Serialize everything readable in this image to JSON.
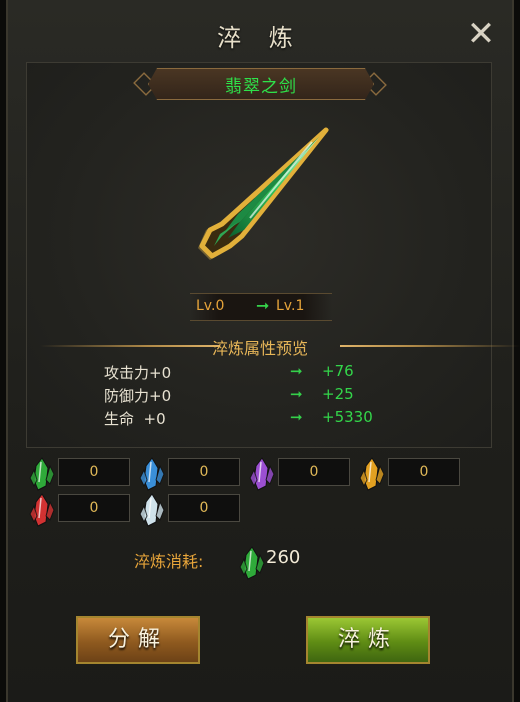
{
  "window": {
    "title": "淬 炼",
    "close_label": "✕"
  },
  "item": {
    "name": "翡翠之剑",
    "icon": "emerald-sword-icon"
  },
  "level": {
    "from": "Lv.0",
    "arrow": "➞",
    "to": "Lv.1"
  },
  "preview": {
    "title": "淬炼属性预览",
    "stats": [
      {
        "label": "攻击力+0",
        "arrow": "➞",
        "value": "+76"
      },
      {
        "label": "防御力+0",
        "arrow": "➞",
        "value": "+25"
      },
      {
        "label": "生命  +0",
        "arrow": "➞",
        "value": "+5330"
      }
    ]
  },
  "materials": [
    {
      "icon": "green-crystal-icon",
      "count": "0",
      "color": "#2faa3a"
    },
    {
      "icon": "blue-crystal-icon",
      "count": "0",
      "color": "#3a8fd8"
    },
    {
      "icon": "purple-crystal-icon",
      "count": "0",
      "color": "#9b4fd1"
    },
    {
      "icon": "orange-crystal-icon",
      "count": "0",
      "color": "#e2a021"
    },
    {
      "icon": "red-crystal-icon",
      "count": "0",
      "color": "#d23232"
    },
    {
      "icon": "white-crystal-icon",
      "count": "0",
      "color": "#cfe2ea"
    }
  ],
  "cost": {
    "label": "淬炼消耗:",
    "icon": "green-crystal-icon",
    "value": "260"
  },
  "buttons": {
    "break_label": "分解",
    "refine_label": "淬炼"
  }
}
